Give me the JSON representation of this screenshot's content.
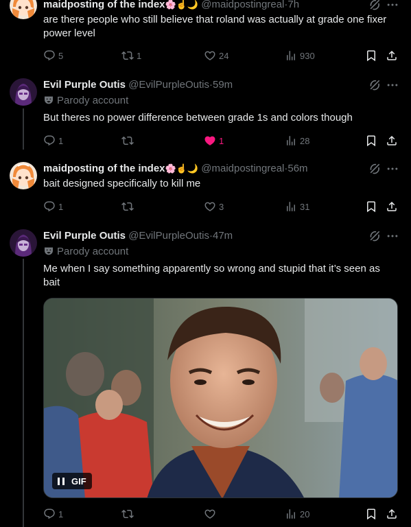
{
  "tweets": [
    {
      "name": "maidposting of the index",
      "emoji": "🌸☝️🌙",
      "handle": "@maidpostingreal",
      "time": "7h",
      "text": "are there people who still believe that roland was actually at grade one fixer power level",
      "replies": "5",
      "retweets": "1",
      "likes": "24",
      "views": "930"
    },
    {
      "name": "Evil Purple Outis",
      "handle": "@EvilPurpleOutis",
      "time": "59m",
      "parody": "Parody account",
      "text": "But theres no power difference between grade 1s and colors though",
      "replies": "1",
      "retweets": "",
      "likes": "1",
      "views": "28"
    },
    {
      "name": "maidposting of the index",
      "emoji": "🌸☝️🌙",
      "handle": "@maidpostingreal",
      "time": "56m",
      "text": "bait designed specifically to kill me",
      "replies": "1",
      "retweets": "",
      "likes": "3",
      "views": "31"
    },
    {
      "name": "Evil Purple Outis",
      "handle": "@EvilPurpleOutis",
      "time": "47m",
      "parody": "Parody account",
      "text": "Me when I say something apparently so wrong and stupid that it’s seen as bait",
      "media_badge": "GIF",
      "replies": "1",
      "retweets": "",
      "likes": "",
      "views": "20"
    }
  ],
  "dot": "·",
  "icons": [
    "reply-icon",
    "retweet-icon",
    "like-icon",
    "views-icon",
    "bookmark-icon",
    "share-icon",
    "grok-icon",
    "more-icon",
    "parody-mask-icon"
  ],
  "colors": {
    "background": "#000000",
    "text": "#e7e9ea",
    "muted": "#71767b",
    "like_active": "#f91880",
    "thread_line": "#333639"
  }
}
